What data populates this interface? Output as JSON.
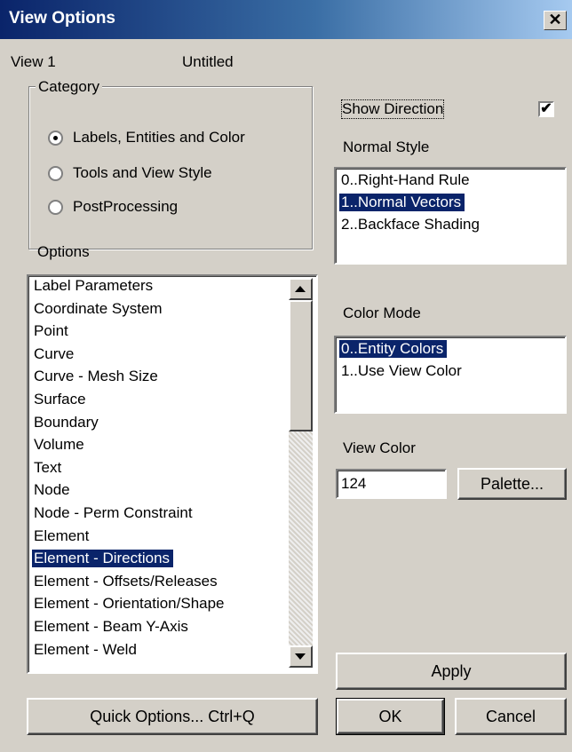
{
  "window": {
    "title": "View Options",
    "close_glyph": "✕"
  },
  "header": {
    "view_label": "View 1",
    "view_name": "Untitled"
  },
  "category": {
    "label": "Category",
    "options": [
      {
        "label": "Labels, Entities and Color",
        "selected": true
      },
      {
        "label": "Tools and View Style",
        "selected": false
      },
      {
        "label": "PostProcessing",
        "selected": false
      }
    ]
  },
  "options": {
    "label": "Options",
    "items": [
      "Label Parameters",
      "Coordinate System",
      "Point",
      "Curve",
      "Curve - Mesh Size",
      "Surface",
      "Boundary",
      "Volume",
      "Text",
      "Node",
      "Node - Perm Constraint",
      "Element",
      "Element - Directions",
      "Element - Offsets/Releases",
      "Element - Orientation/Shape",
      "Element - Beam Y-Axis",
      "Element - Weld"
    ],
    "selected_index": 12
  },
  "show_direction": {
    "label": "Show Direction",
    "checked": true,
    "check_glyph": "✔"
  },
  "normal_style": {
    "label": "Normal Style",
    "items": [
      "0..Right-Hand Rule",
      "1..Normal Vectors",
      "2..Backface Shading"
    ],
    "selected_index": 1
  },
  "color_mode": {
    "label": "Color Mode",
    "items": [
      "0..Entity Colors",
      "1..Use View Color"
    ],
    "selected_index": 0
  },
  "view_color": {
    "label": "View Color",
    "value": "124",
    "palette_button": "Palette..."
  },
  "buttons": {
    "apply": "Apply",
    "quick_options": "Quick Options... Ctrl+Q",
    "ok": "OK",
    "cancel": "Cancel"
  },
  "colors": {
    "title_start": "#0a246a",
    "selection": "#0a246a",
    "face": "#d4d0c8"
  }
}
